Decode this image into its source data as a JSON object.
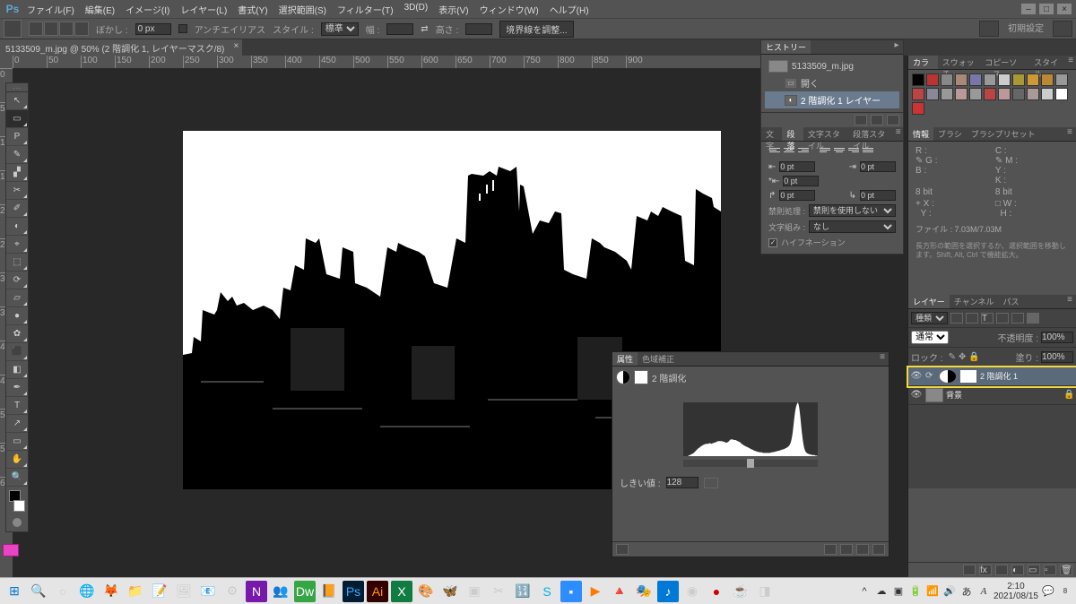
{
  "menubar": {
    "items": [
      "ファイル(F)",
      "編集(E)",
      "イメージ(I)",
      "レイヤー(L)",
      "書式(Y)",
      "選択範囲(S)",
      "フィルター(T)",
      "3D(D)",
      "表示(V)",
      "ウィンドウ(W)",
      "ヘルプ(H)"
    ]
  },
  "optionsbar": {
    "feather_label": "ぼかし :",
    "feather": "0 px",
    "antialias": "アンチエイリアス",
    "style_label": "スタイル :",
    "style": "標準",
    "width_label": "幅 :",
    "height_label": "高さ :",
    "refine": "境界線を調整...",
    "preset": "初期設定"
  },
  "doctab": "5133509_m.jpg @ 50% (2 階調化 1, レイヤーマスク/8)",
  "tools": [
    "↖",
    "▭",
    "P",
    "✎",
    "▞",
    "✂",
    "✐",
    "◐",
    "⌖",
    "⬚",
    "⟳",
    "▱",
    "●",
    "✿",
    "⬛",
    "◧",
    "✒",
    "T",
    "↗",
    "▭",
    "✋",
    "🔍"
  ],
  "ruler_h": [
    "0",
    "50",
    "100",
    "150",
    "200",
    "250",
    "300",
    "350",
    "400",
    "450",
    "500",
    "550",
    "600",
    "650",
    "700",
    "750",
    "800",
    "850",
    "900"
  ],
  "ruler_v": [
    "0",
    "50",
    "100",
    "150",
    "200",
    "250",
    "300",
    "350",
    "400",
    "450",
    "500",
    "550",
    "600"
  ],
  "right": {
    "colortabs": [
      "カラー",
      "スウォッチ",
      "コピーソース",
      "スタイル"
    ],
    "swatches": [
      "#000",
      "#b33",
      "#888",
      "#a87",
      "#77a",
      "#999",
      "#ccc",
      "#a93",
      "#c93",
      "#b83",
      "#999",
      "#b44",
      "#889",
      "#999",
      "#b99",
      "#999",
      "#b44",
      "#b99",
      "#666",
      "#a99",
      "#ccc",
      "#fff",
      "#c33"
    ],
    "infotabs": [
      "情報",
      "ブラシ",
      "ブラシプリセット"
    ],
    "info": {
      "r": "R :",
      "g": "G :",
      "b": "B :",
      "c": "C :",
      "m": "M :",
      "y": "Y :",
      "k": "K :",
      "bit1": "8 bit",
      "bit2": "8 bit",
      "x": "X :",
      "yy": "Y :",
      "w": "W :",
      "h": "H :",
      "file": "ファイル : 7.03M/7.03M",
      "hint": "長方形の範囲を選択するか、選択範囲を移動します。Shift, Alt, Ctrl で機能拡大。"
    },
    "layertabs": [
      "レイヤー",
      "チャンネル",
      "パス"
    ],
    "layers": {
      "kind": "種類",
      "mode": "通常",
      "opacity_label": "不透明度 :",
      "opacity": "100%",
      "lock_label": "ロック :",
      "fill_label": "塗り :",
      "fill": "100%",
      "rows": [
        {
          "name": "2 階調化 1",
          "sel": true,
          "adj": true
        },
        {
          "name": "背景",
          "sel": false,
          "lock": true
        }
      ]
    }
  },
  "mid": {
    "hist_tab": "ヒストリー",
    "hist": [
      {
        "name": "5133509_m.jpg",
        "thumb": true
      },
      {
        "name": "開く",
        "icon": "▭"
      },
      {
        "name": "2 階調化 1 レイヤー",
        "icon": "◐",
        "sel": true
      }
    ],
    "para_tabs": [
      "文字",
      "段落",
      "文字スタイル",
      "段落スタイル"
    ],
    "para": {
      "v1": "0 pt",
      "v2": "0 pt",
      "v3": "0 pt",
      "v4": "0 pt",
      "v5": "0 pt",
      "kinsoku_label": "禁則処理 :",
      "kinsoku": "禁則を使用しない",
      "moji_label": "文字組み :",
      "moji": "なし",
      "hyph": "ハイフネーション"
    }
  },
  "props": {
    "tabs": [
      "属性",
      "色域補正"
    ],
    "type": "2 階調化",
    "thresh_label": "しきい値 :",
    "thresh": "128"
  },
  "status": {
    "zoom": "50%",
    "file": "ファイル : 7.03M/7.03M"
  },
  "taskbar": {
    "tray_ime": "A",
    "clock_time": "2:10",
    "clock_date": "2021/08/15",
    "badge": "8"
  },
  "chart_data": {
    "type": "area",
    "title": "",
    "xlabel": "",
    "ylabel": "",
    "x_range": [
      0,
      255
    ],
    "slider_value": 128,
    "values": [
      0,
      0,
      0,
      0,
      0,
      0,
      0,
      0,
      0,
      0,
      1,
      1,
      2,
      2,
      3,
      3,
      4,
      4,
      5,
      5,
      6,
      7,
      8,
      9,
      10,
      11,
      12,
      13,
      14,
      15,
      15,
      16,
      17,
      18,
      18,
      19,
      20,
      20,
      21,
      21,
      22,
      22,
      22,
      23,
      23,
      23,
      23,
      23,
      23,
      24,
      24,
      24,
      24,
      23,
      23,
      24,
      24,
      24,
      25,
      25,
      25,
      26,
      26,
      26,
      27,
      27,
      28,
      28,
      28,
      28,
      28,
      28,
      28,
      28,
      28,
      27,
      27,
      27,
      26,
      26,
      26,
      25,
      25,
      25,
      26,
      26,
      27,
      28,
      29,
      30,
      31,
      31,
      31,
      31,
      31,
      31,
      30,
      30,
      30,
      30,
      30,
      29,
      29,
      28,
      28,
      27,
      27,
      26,
      26,
      25,
      24,
      23,
      22,
      22,
      21,
      20,
      20,
      19,
      19,
      18,
      18,
      17,
      17,
      16,
      16,
      15,
      15,
      14,
      14,
      13,
      13,
      12,
      12,
      11,
      11,
      10,
      10,
      10,
      9,
      9,
      9,
      8,
      8,
      8,
      8,
      7,
      7,
      7,
      7,
      7,
      7,
      6,
      6,
      6,
      6,
      6,
      6,
      6,
      6,
      6,
      6,
      6,
      6,
      6,
      6,
      6,
      6,
      7,
      7,
      7,
      7,
      7,
      8,
      8,
      8,
      8,
      9,
      9,
      9,
      9,
      10,
      10,
      10,
      10,
      11,
      11,
      11,
      12,
      12,
      12,
      13,
      13,
      13,
      14,
      14,
      15,
      15,
      16,
      16,
      17,
      18,
      19,
      20,
      22,
      24,
      27,
      31,
      36,
      42,
      50,
      59,
      68,
      76,
      83,
      89,
      93,
      96,
      98,
      100,
      98,
      94,
      88,
      80,
      71,
      61,
      51,
      42,
      34,
      27,
      21,
      16,
      13,
      10,
      8,
      7,
      6,
      5,
      5,
      4,
      4,
      4,
      3,
      3,
      3,
      3,
      2,
      2,
      2,
      2,
      2,
      2,
      1,
      1,
      1,
      1,
      1
    ]
  }
}
